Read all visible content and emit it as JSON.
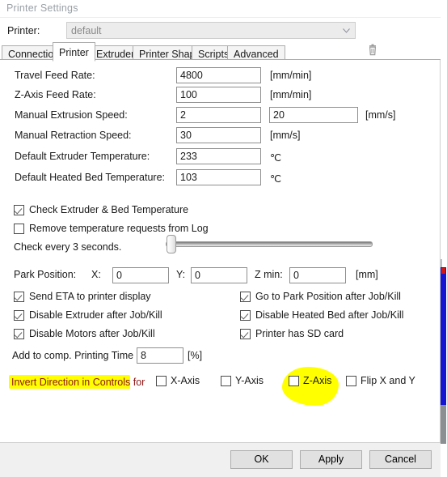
{
  "window": {
    "title": "Printer Settings"
  },
  "printer_selector": {
    "label": "Printer:",
    "selected": "default",
    "options": [
      "default"
    ],
    "delete_icon": "trash-icon",
    "dropdown_icon": "chevron-down-icon"
  },
  "tabs": [
    {
      "label": "Connection",
      "active": false
    },
    {
      "label": "Printer",
      "active": true
    },
    {
      "label": "Extruder",
      "active": false
    },
    {
      "label": "Printer Shape",
      "active": false
    },
    {
      "label": "Scripts",
      "active": false
    },
    {
      "label": "Advanced",
      "active": false
    }
  ],
  "fields": [
    {
      "label": "Travel Feed Rate:",
      "value": "4800",
      "unit": "[mm/min]"
    },
    {
      "label": "Z-Axis Feed Rate:",
      "value": "100",
      "unit": "[mm/min]"
    },
    {
      "label": "Manual Extrusion Speed:",
      "value": "2",
      "value2": "20",
      "unit": "[mm/s]"
    },
    {
      "label": "Manual Retraction Speed:",
      "value": "30",
      "unit": "[mm/s]"
    },
    {
      "label": "Default Extruder Temperature:",
      "value": "233",
      "unit": "℃"
    },
    {
      "label": "Default Heated Bed Temperature:",
      "value": "103",
      "unit": "℃"
    }
  ],
  "temperature_checks": [
    {
      "label": "Check Extruder & Bed Temperature",
      "checked": true
    },
    {
      "label": "Remove temperature requests from Log",
      "checked": false
    }
  ],
  "check_interval": {
    "label": "Check every 3 seconds.",
    "seconds": 3,
    "slider_position_percent": 4
  },
  "park_position": {
    "label": "Park Position:",
    "x_label": "X:",
    "x_value": "0",
    "y_label": "Y:",
    "y_value": "0",
    "zmin_label": "Z min:",
    "zmin_value": "0",
    "unit": "[mm]"
  },
  "job_options_left": [
    {
      "label": "Send ETA to printer display",
      "checked": true
    },
    {
      "label": "Disable Extruder after Job/Kill",
      "checked": true
    },
    {
      "label": "Disable Motors after Job/Kill",
      "checked": true
    }
  ],
  "job_options_right": [
    {
      "label": "Go to Park Position after Job/Kill",
      "checked": true
    },
    {
      "label": "Disable Heated Bed after Job/Kill",
      "checked": true
    },
    {
      "label": "Printer has SD card",
      "checked": true
    }
  ],
  "printing_time": {
    "label": "Add to comp. Printing Time",
    "value": "8",
    "unit": "[%]"
  },
  "invert_direction": {
    "label": "Invert Direction in Controls for",
    "highlight_color": "#ffff00",
    "text_color": "#8c1616",
    "axes": [
      {
        "label": "X-Axis",
        "checked": false,
        "highlighted": false
      },
      {
        "label": "Y-Axis",
        "checked": false,
        "highlighted": false
      },
      {
        "label": "Z-Axis",
        "checked": false,
        "highlighted": true
      },
      {
        "label": "Flip X and Y",
        "checked": false,
        "highlighted": false
      }
    ]
  },
  "footer_buttons": [
    {
      "label": "OK"
    },
    {
      "label": "Apply"
    },
    {
      "label": "Cancel"
    }
  ]
}
